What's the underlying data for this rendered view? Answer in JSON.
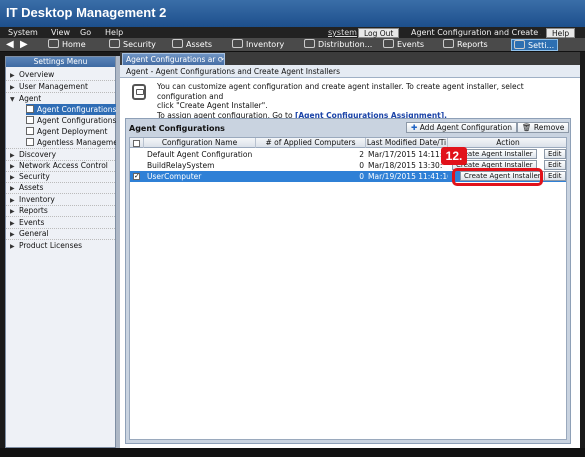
{
  "app": {
    "title": "IT Desktop Management 2"
  },
  "menubar": {
    "items": [
      "System",
      "View",
      "Go",
      "Help"
    ],
    "user": "system",
    "logout": "Log Out",
    "current": "Agent Configuration and Create Ag...",
    "help": "Help"
  },
  "nav": {
    "tabs": [
      {
        "label": "Home",
        "icon": "house-icon"
      },
      {
        "label": "Security",
        "icon": "lock-icon"
      },
      {
        "label": "Assets",
        "icon": "assets-icon"
      },
      {
        "label": "Inventory",
        "icon": "inventory-icon"
      },
      {
        "label": "Distribution...",
        "icon": "distribution-icon"
      },
      {
        "label": "Events",
        "icon": "events-icon"
      },
      {
        "label": "Reports",
        "icon": "reports-icon"
      },
      {
        "label": "Setti...",
        "icon": "settings-icon"
      }
    ]
  },
  "sidebar": {
    "header": "Settings Menu",
    "items": [
      {
        "label": "Overview",
        "expanded": false
      },
      {
        "label": "User Management",
        "expanded": false
      },
      {
        "label": "Agent",
        "expanded": true
      }
    ],
    "agent_children": [
      "Agent Configurations",
      "Agent Configurations",
      "Agent Deployment",
      "Agentless Manageme"
    ],
    "rest": [
      "Discovery",
      "Network Access Control",
      "Security",
      "Assets",
      "Inventory",
      "Reports",
      "Events",
      "General",
      "Product Licenses"
    ]
  },
  "content": {
    "tab_label": "Agent Configurations ar",
    "breadcrumb": "Agent - Agent Configurations and Create Agent Installers",
    "info_line1": "You can customize agent configuration and create agent installer. To create agent installer, select configuration and",
    "info_line2": "click \"Create Agent Installer\".",
    "info_line3_prefix": "To assign agent configuration, Go to ",
    "info_link": "[Agent Configurations Assignment].",
    "section_title": "Agent Configurations",
    "add_button": "Add Agent Configuration",
    "remove_button": "Remove",
    "columns": [
      "Configuration Name",
      "# of Applied Computers",
      "Last Modified Date/Ti",
      "Action"
    ],
    "rows": [
      {
        "name": "Default Agent Configuration",
        "count": "2",
        "date": "Mar/17/2015 14:11:",
        "action": "Create Agent Installer",
        "edit": "Edit",
        "checked": false,
        "selected": false
      },
      {
        "name": "BuildRelaySystem",
        "count": "0",
        "date": "Mar/18/2015 13:30:",
        "action": "Create Agent Installer",
        "edit": "Edit",
        "checked": false,
        "selected": false
      },
      {
        "name": "UserComputer",
        "count": "0",
        "date": "Mar/19/2015 11:41:16",
        "action": "Create Agent Installer",
        "edit": "Edit",
        "checked": true,
        "selected": true
      }
    ],
    "step_badge": "12."
  },
  "colors": {
    "accent": "#2f6db5",
    "highlight": "#e1121a",
    "selection": "#2f80d6"
  }
}
